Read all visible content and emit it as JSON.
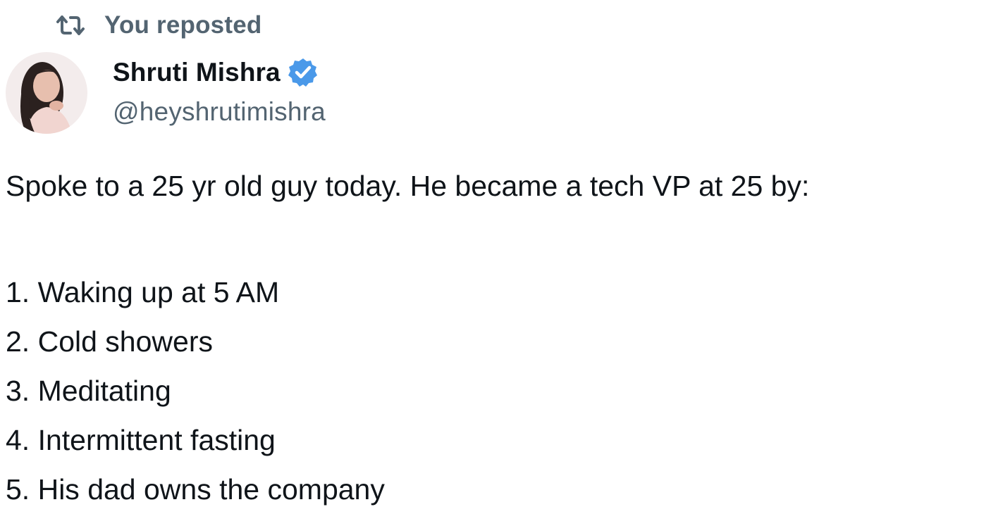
{
  "repost": {
    "icon": "repost-icon",
    "label": "You reposted"
  },
  "author": {
    "avatar_icon": "avatar",
    "name": "Shruti Mishra",
    "verified_icon": "verified-badge-icon",
    "verified_color": "#4a99e9",
    "handle": "@heyshrutimishra"
  },
  "tweet": {
    "text": "Spoke to a 25 yr old guy today. He became a tech VP at 25 by:",
    "list": [
      "1. Waking up at 5 AM",
      "2. Cold showers",
      "3. Meditating",
      "4. Intermittent fasting",
      "5. His dad owns the company"
    ]
  },
  "colors": {
    "text_primary": "#0f1419",
    "text_secondary": "#536471",
    "background": "#ffffff"
  }
}
